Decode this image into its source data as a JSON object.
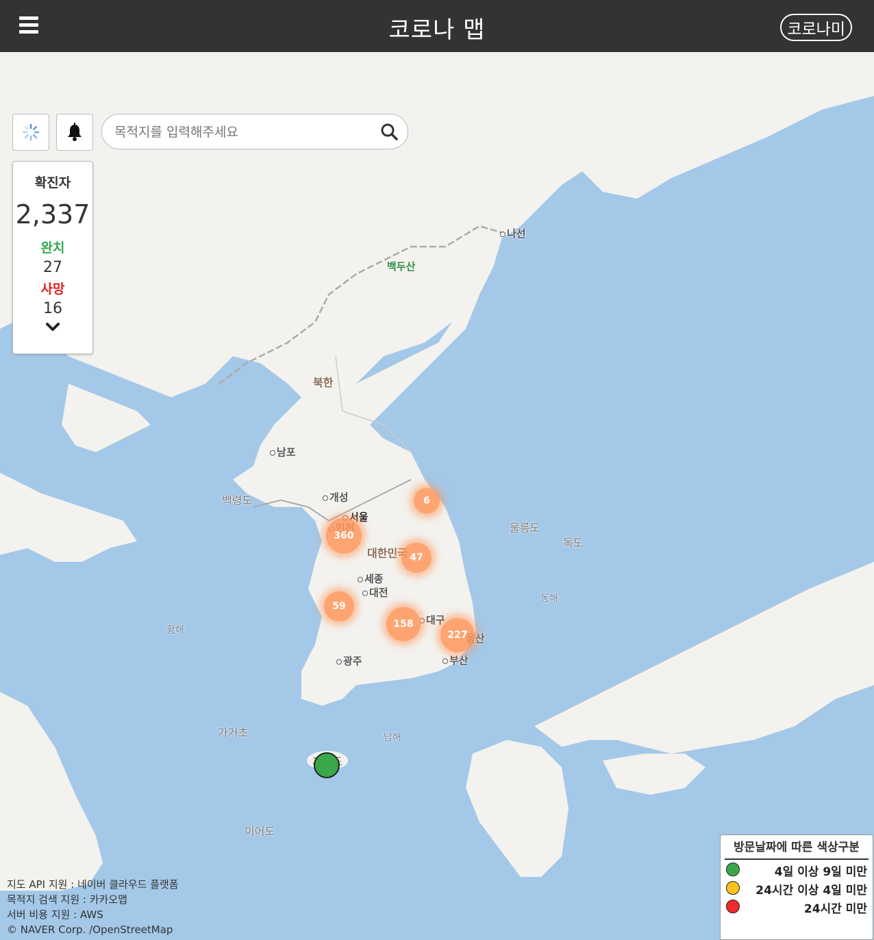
{
  "header": {
    "title": "코로나 맵",
    "corona_me": "코로나미"
  },
  "search": {
    "placeholder": "목적지를 입력해주세요"
  },
  "stats": {
    "confirmed_label": "확진자",
    "confirmed": "2,337",
    "cured_label": "완치",
    "cured": "27",
    "dead_label": "사망",
    "dead": "16"
  },
  "places": {
    "naseon": "나선",
    "baekdusan": "백두산",
    "bukhan": "북한",
    "nampo": "남포",
    "gaeseong": "개성",
    "baengnyeongdo": "백령도",
    "seoul": "서울",
    "incheon": "인천",
    "daehanminguk": "대한민국",
    "sejong": "세종",
    "daejeon": "대전",
    "daegu": "대구",
    "gwangju": "광주",
    "busan": "부산",
    "ulsan": "울산",
    "ulleungdo": "울릉도",
    "dokdo": "독도",
    "donghae": "동해",
    "hwanghae": "황해",
    "namhae": "남해",
    "gageocho": "가거초",
    "jejudo": "제주도",
    "ieodo": "이어도"
  },
  "clusters": [
    {
      "name": "gangwon",
      "count": "6"
    },
    {
      "name": "seoul-incheon",
      "count": "360"
    },
    {
      "name": "gyeongbuk",
      "count": "47"
    },
    {
      "name": "jeonbuk",
      "count": "59"
    },
    {
      "name": "daegu",
      "count": "158"
    },
    {
      "name": "ulsan",
      "count": "227"
    }
  ],
  "legend": {
    "title": "방문날짜에 따른 색상구분",
    "items": [
      {
        "label": "4일 이상 9일 미만",
        "color": "#3aa84a"
      },
      {
        "label": "24시간 이상 4일 미만",
        "color": "#f8c31a"
      },
      {
        "label": "24시간 미만",
        "color": "#ee2a2a"
      }
    ]
  },
  "credits": [
    "지도 API 지원 : 네이버 클라우드 플랫폼",
    "목적지 검색 지원 : 카카오맵",
    "서버 비용 지원 : AWS",
    "© NAVER Corp. /OpenStreetMap"
  ],
  "colors": {
    "header": "#333333",
    "sea": "#a4c8e8",
    "land": "#f3f2ee",
    "cluster": "#ff965a",
    "marker_green": "#3aa84a"
  }
}
